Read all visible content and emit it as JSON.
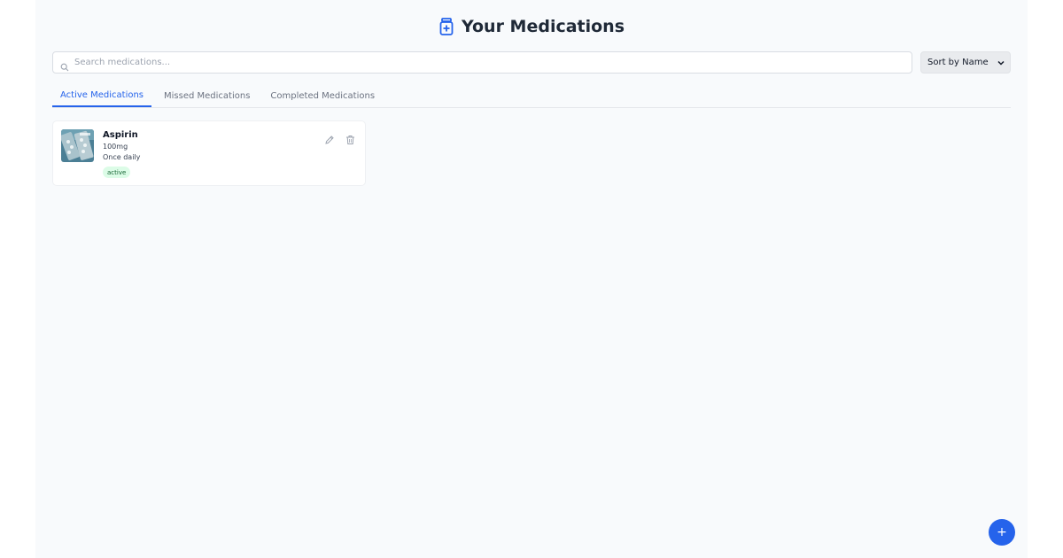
{
  "header": {
    "title": "Your Medications",
    "icon": "medicine-bottle-icon",
    "accent_color": "#2563eb"
  },
  "search": {
    "placeholder": "Search medications...",
    "value": ""
  },
  "sort": {
    "selected": "Sort by Name"
  },
  "tabs": [
    {
      "label": "Active Medications",
      "active": true
    },
    {
      "label": "Missed Medications",
      "active": false
    },
    {
      "label": "Completed Medications",
      "active": false
    }
  ],
  "medications": [
    {
      "name": "Aspirin",
      "dose": "100mg",
      "frequency": "Once daily",
      "status": "active",
      "status_color": "#dcfce7"
    }
  ],
  "fab": {
    "label": "+",
    "color": "#2563eb"
  }
}
